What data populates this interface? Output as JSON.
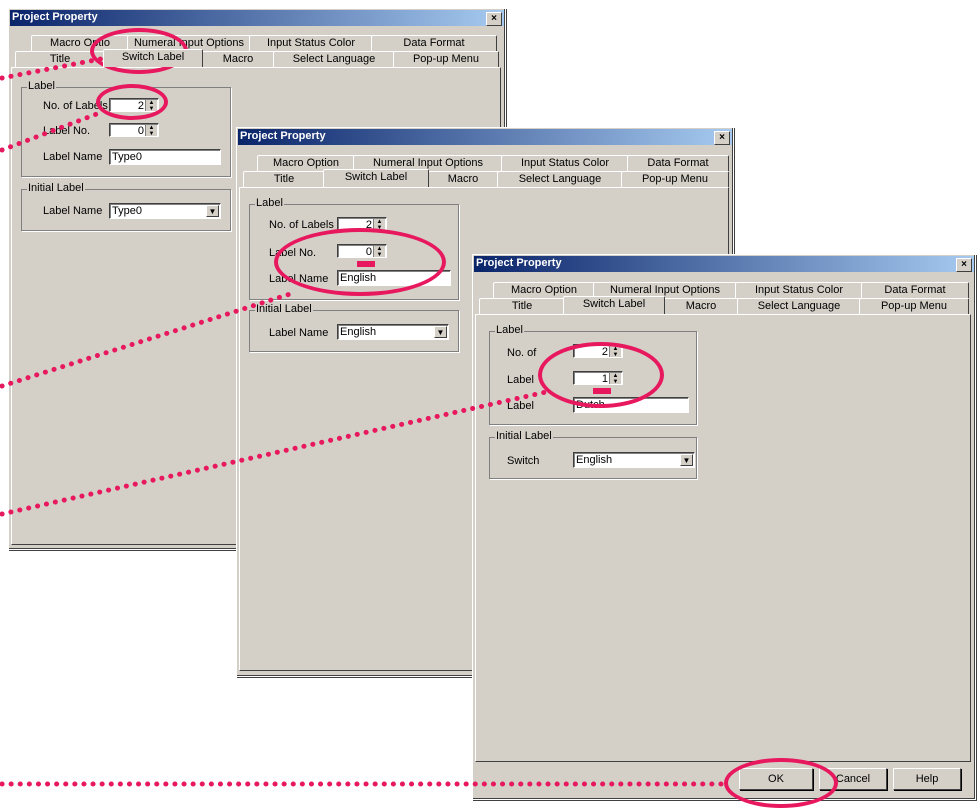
{
  "title": "Project Property",
  "tabs_row1": [
    "Macro Option",
    "Numeral Input Options",
    "Input Status Color",
    "Data Format"
  ],
  "tabs_row2": [
    "Title",
    "Switch Label",
    "Macro",
    "Select Language",
    "Pop-up Menu"
  ],
  "close_glyph": "×",
  "group_label": "Label",
  "group_initial": "Initial Label",
  "dlg1": {
    "tab_macro_option": "Macro Optio",
    "tab_numeral": "Numeral Input Options",
    "no_of_labels_label": "No. of Labels",
    "no_of_labels_value": "2",
    "label_no_label": "Label No.",
    "label_no_value": "0",
    "label_name_label": "Label Name",
    "label_name_value": "Type0",
    "initial_label_name_label": "Label Name",
    "initial_label_name_value": "Type0"
  },
  "dlg2": {
    "no_of_labels_label": "No. of Labels",
    "no_of_labels_value": "2",
    "label_no_label": "Label No.",
    "label_no_value": "0",
    "label_name_label": "Label Name",
    "label_name_value": "English",
    "initial_label_name_label": "Label Name",
    "initial_label_name_value": "English"
  },
  "dlg3": {
    "no_of_labels_label": "No. of",
    "no_of_labels_value": "2",
    "label_no_label": "Label",
    "label_no_value": "1",
    "label_name_label": "Label",
    "label_name_value": "Dutch",
    "initial_switch_label": "Switch",
    "initial_switch_value": "English",
    "ok_label": "OK",
    "cancel_label": "Cancel",
    "help_label": "Help"
  },
  "colors": {
    "highlight": "#e8185e",
    "dialog_bg": "#d4d0c8",
    "title_bar": "#0a246a"
  }
}
